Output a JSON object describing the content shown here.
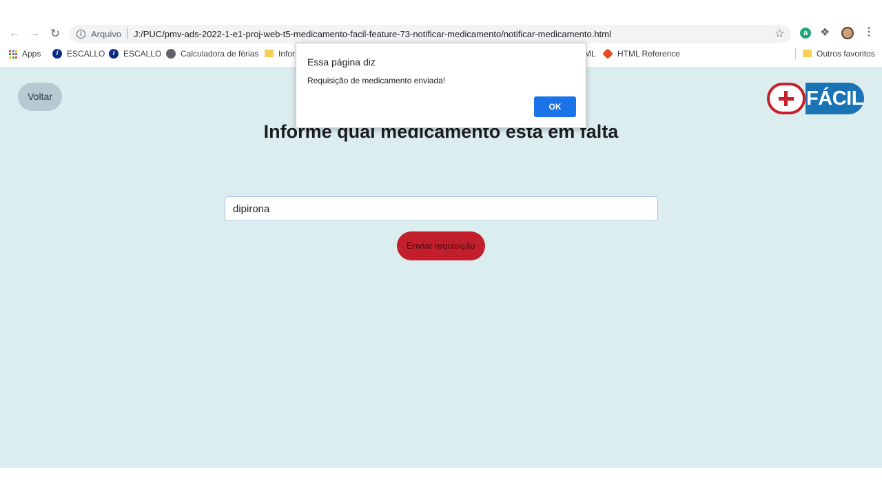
{
  "browser": {
    "url_scheme": "Arquivo",
    "url": "J:/PUC/pmv-ads-2022-1-e1-proj-web-t5-medicamento-facil-feature-73-notificar-medicamento/notificar-medicamento.html",
    "extension_letter": "a"
  },
  "bookmarks": [
    {
      "label": "Apps",
      "icon": "apps-grid-icon"
    },
    {
      "label": "ESCALLO",
      "icon": "escallo-icon"
    },
    {
      "label": "ESCALLO",
      "icon": "escallo-icon"
    },
    {
      "label": "Calculadora de férias",
      "icon": "globe-icon"
    },
    {
      "label": "Infor",
      "icon": "folder-icon"
    },
    {
      "label": "ML",
      "icon": "folder-icon"
    },
    {
      "label": "HTML Reference",
      "icon": "html-icon"
    },
    {
      "label": "Outros favoritos",
      "icon": "folder-icon"
    }
  ],
  "page": {
    "back_label": "Voltar",
    "logo_text": "FÁCIL",
    "heading": "Informe qual medicamento está em falta",
    "input_value": "dipirona",
    "send_label": "Enviar requisição"
  },
  "dialog": {
    "title": "Essa página diz",
    "message": "Requisição de medicamento enviada!",
    "ok_label": "OK"
  },
  "colors": {
    "page_bg": "#dcedf0",
    "send_button": "#c21e2b",
    "logo_red": "#c8202a",
    "logo_blue": "#1a73b5",
    "ok_button": "#1a73e8"
  }
}
